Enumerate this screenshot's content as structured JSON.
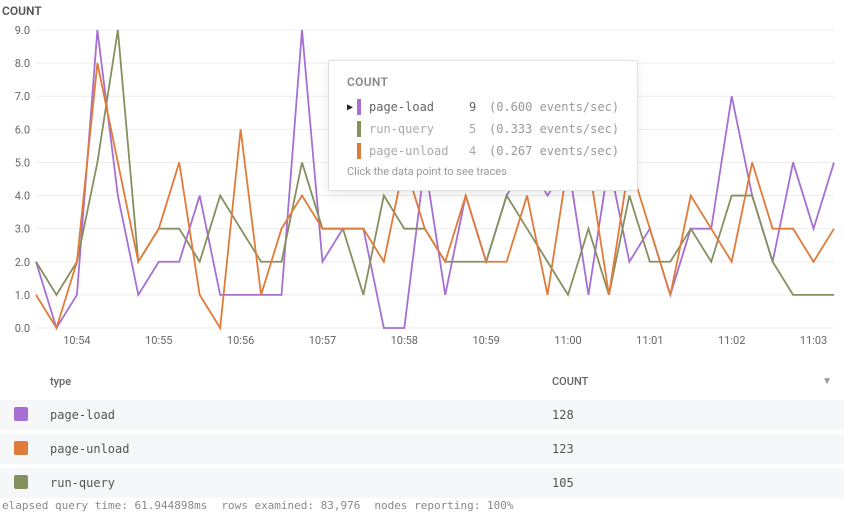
{
  "title": "COUNT",
  "colors": {
    "page_load": "#a76fd4",
    "page_unload": "#e07b39",
    "run_query": "#86905f"
  },
  "chart_data": {
    "type": "line",
    "ylabel": "COUNT",
    "ylim": [
      0,
      9
    ],
    "yticks": [
      0.0,
      1.0,
      2.0,
      3.0,
      4.0,
      5.0,
      6.0,
      7.0,
      8.0,
      9.0
    ],
    "xticks": [
      "10:54",
      "10:55",
      "10:56",
      "10:57",
      "10:58",
      "10:59",
      "11:00",
      "11:01",
      "11:02",
      "11:03"
    ],
    "cursor_time": "10:56:46",
    "categories": [
      "10:53:30",
      "10:53:45",
      "10:54:00",
      "10:54:15",
      "10:54:30",
      "10:54:45",
      "10:55:00",
      "10:55:15",
      "10:55:30",
      "10:55:45",
      "10:56:00",
      "10:56:15",
      "10:56:30",
      "10:56:45",
      "10:57:00",
      "10:57:15",
      "10:57:30",
      "10:57:45",
      "10:58:00",
      "10:58:15",
      "10:58:30",
      "10:58:45",
      "10:59:00",
      "10:59:15",
      "10:59:30",
      "10:59:45",
      "11:00:00",
      "11:00:15",
      "11:00:30",
      "11:00:45",
      "11:01:00",
      "11:01:15",
      "11:01:30",
      "11:01:45",
      "11:02:00",
      "11:02:15",
      "11:02:30",
      "11:02:45",
      "11:03:00",
      "11:03:15"
    ],
    "series": [
      {
        "name": "page-load",
        "color_key": "page_load",
        "values": [
          2,
          0,
          1,
          9,
          4,
          1,
          2,
          2,
          4,
          1,
          1,
          1,
          1,
          9,
          2,
          3,
          3,
          0,
          0,
          5,
          1,
          4,
          2,
          4,
          5,
          4,
          5,
          1,
          5,
          2,
          3,
          1,
          3,
          3,
          7,
          4,
          2,
          5,
          3,
          5
        ]
      },
      {
        "name": "run-query",
        "color_key": "run_query",
        "values": [
          2,
          1,
          2,
          5,
          9,
          2,
          3,
          3,
          2,
          4,
          3,
          2,
          2,
          5,
          3,
          3,
          1,
          4,
          3,
          3,
          2,
          2,
          2,
          4,
          3,
          2,
          1,
          3,
          1,
          4,
          2,
          2,
          3,
          2,
          4,
          4,
          2,
          1,
          1,
          1
        ]
      },
      {
        "name": "page-unload",
        "color_key": "page_unload",
        "values": [
          1,
          0,
          2,
          8,
          5,
          2,
          3,
          5,
          1,
          0,
          6,
          1,
          3,
          4,
          3,
          3,
          3,
          2,
          5,
          3,
          2,
          4,
          2,
          2,
          4,
          1,
          5,
          5,
          1,
          5,
          3,
          1,
          4,
          3,
          2,
          5,
          3,
          3,
          2,
          3
        ]
      }
    ]
  },
  "tooltip": {
    "title": "COUNT",
    "rows": [
      {
        "name": "page-load",
        "value": 9,
        "rate": "(0.600 events/sec)",
        "color_key": "page_load",
        "active": true
      },
      {
        "name": "run-query",
        "value": 5,
        "rate": "(0.333 events/sec)",
        "color_key": "run_query",
        "active": false
      },
      {
        "name": "page-unload",
        "value": 4,
        "rate": "(0.267 events/sec)",
        "color_key": "page_unload",
        "active": false
      }
    ],
    "hint": "Click the data point to see traces"
  },
  "table": {
    "headers": {
      "type": "type",
      "count": "COUNT"
    },
    "rows": [
      {
        "type": "page-load",
        "count": 128,
        "color_key": "page_load"
      },
      {
        "type": "page-unload",
        "count": 123,
        "color_key": "page_unload"
      },
      {
        "type": "run-query",
        "count": 105,
        "color_key": "run_query"
      }
    ]
  },
  "footer": {
    "elapsed_label": "elapsed query time:",
    "elapsed_value": "61.944898ms",
    "rows_label": "rows examined:",
    "rows_value": "83,976",
    "nodes_label": "nodes reporting:",
    "nodes_value": "100%"
  }
}
